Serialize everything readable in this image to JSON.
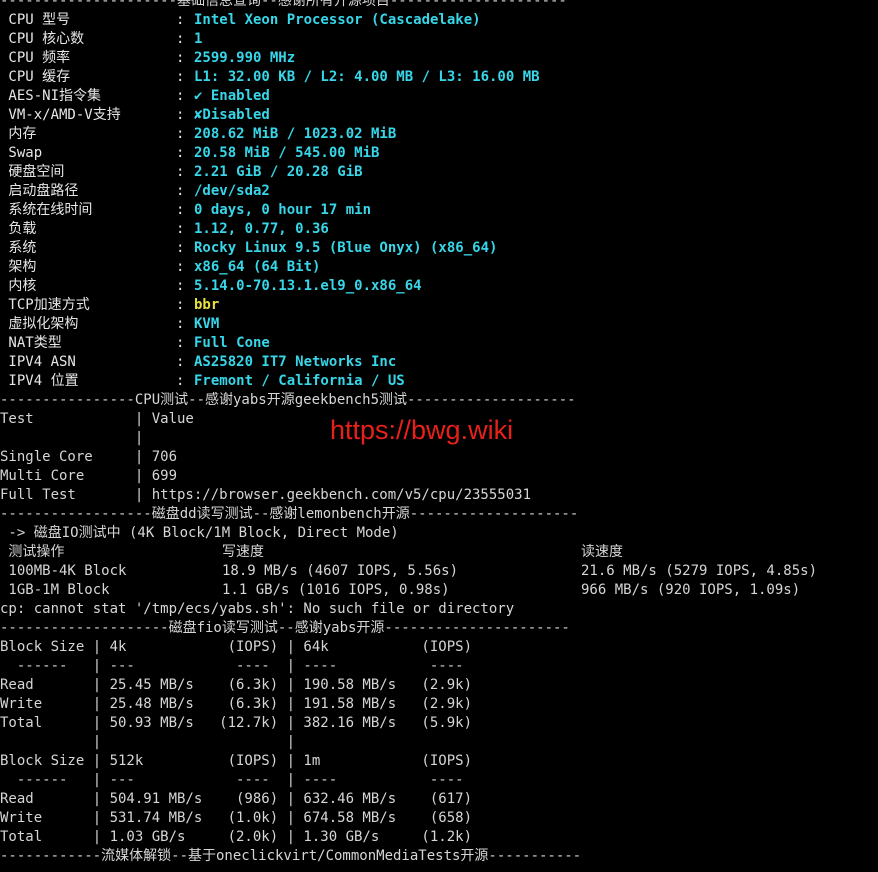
{
  "basic_info": {
    "separator": "---------------------基础信息查询--感谢所有开源项目---------------------",
    "rows": [
      {
        "label": " CPU 型号",
        "value": "Intel Xeon Processor (Cascadelake)",
        "color": "#37d6e8"
      },
      {
        "label": " CPU 核心数",
        "value": "1",
        "color": "#37d6e8"
      },
      {
        "label": " CPU 频率",
        "value": "2599.990 MHz",
        "color": "#37d6e8"
      },
      {
        "label": " CPU 缓存",
        "value": "L1: 32.00 KB / L2: 4.00 MB / L3: 16.00 MB",
        "color": "#37d6e8"
      },
      {
        "label": " AES-NI指令集",
        "value": "✔ Enabled",
        "color": "#37d6e8"
      },
      {
        "label": " VM-x/AMD-V支持",
        "value": "✘Disabled",
        "color": "#37d6e8"
      },
      {
        "label": " 内存",
        "value": "208.62 MiB / 1023.02 MiB",
        "color": "#37d6e8"
      },
      {
        "label": " Swap",
        "value": "20.58 MiB / 545.00 MiB",
        "color": "#37d6e8"
      },
      {
        "label": " 硬盘空间",
        "value": "2.21 GiB / 20.28 GiB",
        "color": "#37d6e8"
      },
      {
        "label": " 启动盘路径",
        "value": "/dev/sda2",
        "color": "#37d6e8"
      },
      {
        "label": " 系统在线时间",
        "value": "0 days, 0 hour 17 min",
        "color": "#37d6e8"
      },
      {
        "label": " 负载",
        "value": "1.12, 0.77, 0.36",
        "color": "#37d6e8"
      },
      {
        "label": " 系统",
        "value": "Rocky Linux 9.5 (Blue Onyx) (x86_64)",
        "color": "#37d6e8"
      },
      {
        "label": " 架构",
        "value": "x86_64 (64 Bit)",
        "color": "#37d6e8"
      },
      {
        "label": " 内核",
        "value": "5.14.0-70.13.1.el9_0.x86_64",
        "color": "#37d6e8"
      },
      {
        "label": " TCP加速方式",
        "value": "bbr",
        "color": "#e8e040"
      },
      {
        "label": " 虚拟化架构",
        "value": "KVM",
        "color": "#37d6e8"
      },
      {
        "label": " NAT类型",
        "value": "Full Cone",
        "color": "#37d6e8"
      },
      {
        "label": " IPV4 ASN",
        "value": "AS25820 IT7 Networks Inc",
        "color": "#37d6e8"
      },
      {
        "label": " IPV4 位置",
        "value": "Fremont / California / US",
        "color": "#37d6e8"
      }
    ]
  },
  "cpu_test": {
    "separator": "----------------CPU测试--感谢yabs开源geekbench5测试--------------------",
    "lines": [
      "Test            | Value",
      "                |",
      "Single Core     | 706",
      "Multi Core      | 699",
      "Full Test       | https://browser.geekbench.com/v5/cpu/23555031"
    ]
  },
  "watermark": "https://bwg.wiki",
  "disk_dd": {
    "separator": "------------------磁盘dd读写测试--感谢lemonbench开源--------------------",
    "mode_line": " -> 磁盘IO测试中 (4K Block/1M Block, Direct Mode)",
    "header": {
      "op": " 测试操作",
      "write": "写速度",
      "read": "读速度"
    },
    "rows": [
      {
        "op": " 100MB-4K Block",
        "write": "18.9 MB/s (4607 IOPS, 5.56s)",
        "read": "21.6 MB/s (5279 IOPS, 4.85s)"
      },
      {
        "op": " 1GB-1M Block",
        "write": "1.1 GB/s (1016 IOPS, 0.98s)",
        "read": "966 MB/s (920 IOPS, 1.09s)"
      }
    ],
    "error": "cp: cannot stat '/tmp/ecs/yabs.sh': No such file or directory"
  },
  "disk_fio": {
    "separator": "--------------------磁盘fio读写测试--感谢yabs开源----------------------",
    "lines": [
      "Block Size | 4k            (IOPS) | 64k           (IOPS)",
      "  ------   | ---            ----  | ----           ----",
      "Read       | 25.45 MB/s    (6.3k) | 190.58 MB/s   (2.9k)",
      "Write      | 25.48 MB/s    (6.3k) | 191.58 MB/s   (2.9k)",
      "Total      | 50.93 MB/s   (12.7k) | 382.16 MB/s   (5.9k)",
      "           |                      |",
      "Block Size | 512k          (IOPS) | 1m            (IOPS)",
      "  ------   | ---            ----  | ----           ----",
      "Read       | 504.91 MB/s    (986) | 632.46 MB/s    (617)",
      "Write      | 531.74 MB/s   (1.0k) | 674.58 MB/s    (658)",
      "Total      | 1.03 GB/s     (2.0k) | 1.30 GB/s     (1.2k)"
    ]
  },
  "media": {
    "separator": "------------流媒体解锁--基于oneclickvirt/CommonMediaTests开源-----------"
  }
}
